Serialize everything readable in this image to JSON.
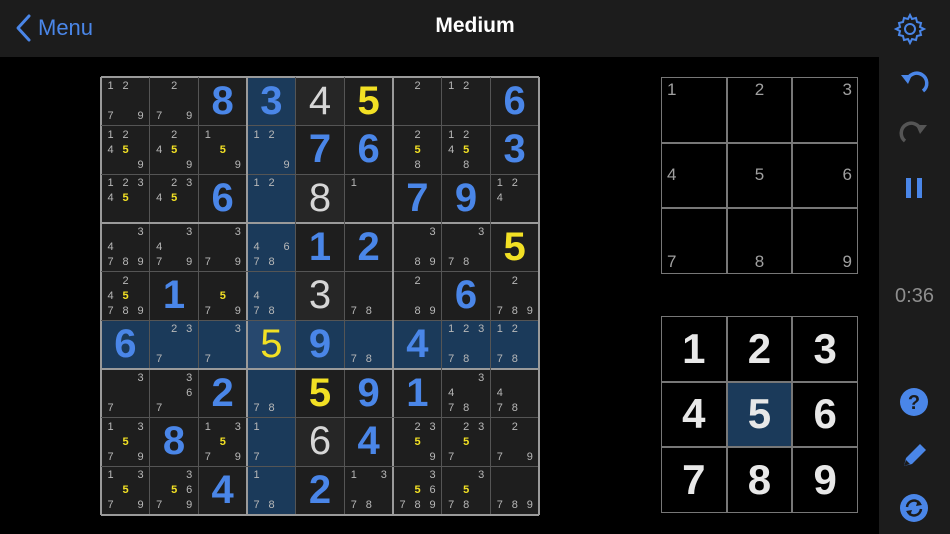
{
  "header": {
    "back_label": "Menu",
    "title": "Medium"
  },
  "timer": "0:36",
  "icons": {
    "back": "chevron-left-icon",
    "settings": "gear-icon",
    "undo": "undo-icon",
    "redo": "redo-icon",
    "pause": "pause-icon",
    "help": "question-icon",
    "pencil": "pencil-icon",
    "autofill": "refresh-icon"
  },
  "colors": {
    "accent": "#4a86e8",
    "highlight_yellow": "#f2e024",
    "cell_highlight": "#1b3a5a",
    "bar_background": "#1c1c1c"
  },
  "selected_number": "5",
  "note_pad": {
    "digits": [
      "1",
      "2",
      "3",
      "4",
      "5",
      "6",
      "7",
      "8",
      "9"
    ]
  },
  "number_pad": {
    "digits": [
      "1",
      "2",
      "3",
      "4",
      "5",
      "6",
      "7",
      "8",
      "9"
    ],
    "active": "5"
  },
  "board": {
    "selected": [
      5,
      3
    ],
    "rows": [
      [
        {
          "c": "127|9"
        },
        {
          "c": "2|79"
        },
        {
          "v": "8",
          "t": "u"
        },
        {
          "v": "3",
          "t": "u"
        },
        {
          "v": "4",
          "t": "g"
        },
        {
          "v": "5",
          "t": "y"
        },
        {
          "c": "2"
        },
        {
          "c": "12"
        },
        {
          "v": "6",
          "t": "u"
        }
      ],
      [
        {
          "c": "12459"
        },
        {
          "c": "2459"
        },
        {
          "c": "159"
        },
        {
          "c": "129"
        },
        {
          "v": "7",
          "t": "u"
        },
        {
          "v": "6",
          "t": "u"
        },
        {
          "c": "258"
        },
        {
          "c": "12458"
        },
        {
          "v": "3",
          "t": "u"
        }
      ],
      [
        {
          "c": "12345"
        },
        {
          "c": "2345"
        },
        {
          "v": "6",
          "t": "u"
        },
        {
          "c": "12"
        },
        {
          "v": "8",
          "t": "g"
        },
        {
          "c": "1"
        },
        {
          "v": "7",
          "t": "u"
        },
        {
          "v": "9",
          "t": "u"
        },
        {
          "c": "124"
        }
      ],
      [
        {
          "c": "34789"
        },
        {
          "c": "3479"
        },
        {
          "c": "379"
        },
        {
          "c": "4678"
        },
        {
          "v": "1",
          "t": "u"
        },
        {
          "v": "2",
          "t": "u"
        },
        {
          "c": "389"
        },
        {
          "c": "378"
        },
        {
          "v": "5",
          "t": "y"
        }
      ],
      [
        {
          "c": "245789"
        },
        {
          "v": "1",
          "t": "u"
        },
        {
          "c": "579"
        },
        {
          "c": "478"
        },
        {
          "v": "3",
          "t": "g"
        },
        {
          "c": "78"
        },
        {
          "c": "289"
        },
        {
          "v": "6",
          "t": "u"
        },
        {
          "c": "2789"
        }
      ],
      [
        {
          "v": "6",
          "t": "u"
        },
        {
          "c": "237"
        },
        {
          "c": "37"
        },
        {
          "v": "5",
          "t": "hi"
        },
        {
          "v": "9",
          "t": "u"
        },
        {
          "c": "78"
        },
        {
          "v": "4",
          "t": "u"
        },
        {
          "c": "12378"
        },
        {
          "c": "1278"
        }
      ],
      [
        {
          "c": "37"
        },
        {
          "c": "367"
        },
        {
          "v": "2",
          "t": "u"
        },
        {
          "c": "78"
        },
        {
          "v": "5",
          "t": "y"
        },
        {
          "v": "9",
          "t": "u"
        },
        {
          "v": "1",
          "t": "u"
        },
        {
          "c": "3478"
        },
        {
          "c": "478"
        }
      ],
      [
        {
          "c": "13579"
        },
        {
          "v": "8",
          "t": "u"
        },
        {
          "c": "13579"
        },
        {
          "c": "17"
        },
        {
          "v": "6",
          "t": "g"
        },
        {
          "v": "4",
          "t": "u"
        },
        {
          "c": "2359"
        },
        {
          "c": "2357"
        },
        {
          "c": "279"
        }
      ],
      [
        {
          "c": "13579"
        },
        {
          "c": "35679"
        },
        {
          "v": "4",
          "t": "u"
        },
        {
          "c": "178"
        },
        {
          "v": "2",
          "t": "u"
        },
        {
          "c": "1378"
        },
        {
          "c": "356789"
        },
        {
          "c": "3578"
        },
        {
          "c": "789"
        }
      ]
    ]
  }
}
